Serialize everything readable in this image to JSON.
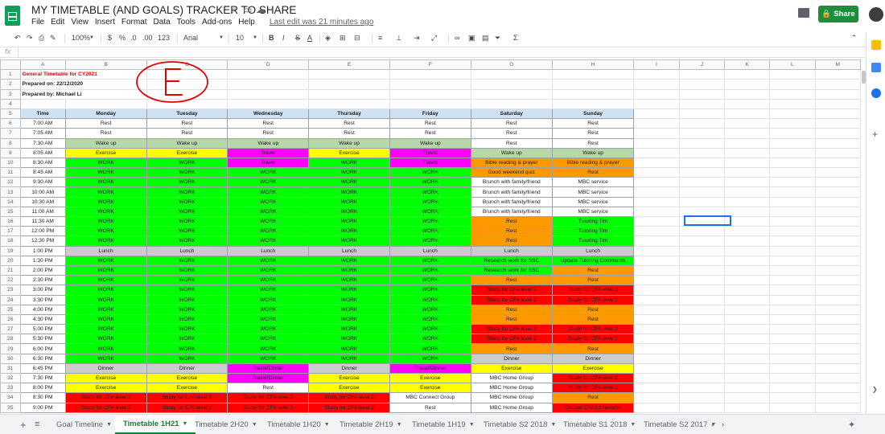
{
  "app": {
    "title": "MY TIMETABLE (AND GOALS) TRACKER TO SHARE",
    "last_edit": "Last edit was 21 minutes ago",
    "share": "Share"
  },
  "menu": [
    "File",
    "Edit",
    "View",
    "Insert",
    "Format",
    "Data",
    "Tools",
    "Add-ons",
    "Help"
  ],
  "toolbar": {
    "zoom": "100%",
    "currency": "$",
    "percent": "%",
    "dec_less": ".0",
    "dec_more": ".00",
    "more_formats": "123",
    "font": "Arial",
    "font_size": "10",
    "bold": "B",
    "italic": "I",
    "strike": "S",
    "text_color": "A"
  },
  "formula_bar": {
    "fx": "fx",
    "value": ""
  },
  "columns": [
    "A",
    "B",
    "C",
    "D",
    "E",
    "F",
    "G",
    "H",
    "I",
    "J",
    "K",
    "L",
    "M"
  ],
  "info_rows": [
    "General Timetable for CY2021",
    "Prepared on: 22/12/2020",
    "Prepared by: Michael Li"
  ],
  "timetable": {
    "header": [
      "Time",
      "Monday",
      "Tuesday",
      "Wednesday",
      "Thursday",
      "Friday",
      "Saturday",
      "Sunday"
    ],
    "rows": [
      [
        "7:00 AM",
        "Rest",
        "Rest",
        "Rest",
        "Rest",
        "Rest",
        "Rest",
        "Rest"
      ],
      [
        "7:05 AM",
        "Rest",
        "Rest",
        "Rest",
        "Rest",
        "Rest",
        "Rest",
        "Rest"
      ],
      [
        "7:30 AM",
        "Wake up",
        "Wake up",
        "Wake up",
        "Wake up",
        "Wake up",
        "Rest",
        "Rest"
      ],
      [
        "8:05 AM",
        "Exercise",
        "Exercise",
        "Travel",
        "Exercise",
        "Travel",
        "Wake up",
        "Wake up"
      ],
      [
        "8:30 AM",
        "WORK",
        "WORK",
        "Travel",
        "WORK",
        "Travel",
        "Bible reading & prayer",
        "Bible reading & prayer"
      ],
      [
        "8:45 AM",
        "WORK",
        "WORK",
        "WORK",
        "WORK",
        "WORK",
        "Good weekend quiz",
        "Rest"
      ],
      [
        "9:30 AM",
        "WORK",
        "WORK",
        "WORK",
        "WORK",
        "WORK",
        "Brunch with family/friend",
        "MBC service"
      ],
      [
        "10:00 AM",
        "WORK",
        "WORK",
        "WORK",
        "WORK",
        "WORK",
        "Brunch with family/friend",
        "MBC service"
      ],
      [
        "10:30 AM",
        "WORK",
        "WORK",
        "WORK",
        "WORK",
        "WORK",
        "Brunch with family/friend",
        "MBC service"
      ],
      [
        "11:00 AM",
        "WORK",
        "WORK",
        "WORK",
        "WORK",
        "WORK",
        "Brunch with family/friend",
        "MBC service"
      ],
      [
        "11:30 AM",
        "WORK",
        "WORK",
        "WORK",
        "WORK",
        "WORK",
        "Rest",
        "Tutoring Tim"
      ],
      [
        "12:00 PM",
        "WORK",
        "WORK",
        "WORK",
        "WORK",
        "WORK",
        "Rest",
        "Tutoring Tim"
      ],
      [
        "12:30 PM",
        "WORK",
        "WORK",
        "WORK",
        "WORK",
        "WORK",
        "Rest",
        "Tutoring Tim"
      ],
      [
        "1:00 PM",
        "Lunch",
        "Lunch",
        "Lunch",
        "Lunch",
        "Lunch",
        "Lunch",
        "Lunch"
      ],
      [
        "1:30 PM",
        "WORK",
        "WORK",
        "WORK",
        "WORK",
        "WORK",
        "Research work for SSC",
        "Update Tutoring Comments"
      ],
      [
        "2:00 PM",
        "WORK",
        "WORK",
        "WORK",
        "WORK",
        "WORK",
        "Research work for SSC",
        "Rest"
      ],
      [
        "2:30 PM",
        "WORK",
        "WORK",
        "WORK",
        "WORK",
        "WORK",
        "Rest",
        "Rest"
      ],
      [
        "3:00 PM",
        "WORK",
        "WORK",
        "WORK",
        "WORK",
        "WORK",
        "Study for CFA level 2",
        "Study for CFA level 2"
      ],
      [
        "3:30 PM",
        "WORK",
        "WORK",
        "WORK",
        "WORK",
        "WORK",
        "Study for CFA level 2",
        "Study for CFA level 2"
      ],
      [
        "4:00 PM",
        "WORK",
        "WORK",
        "WORK",
        "WORK",
        "WORK",
        "Rest",
        "Rest"
      ],
      [
        "4:30 PM",
        "WORK",
        "WORK",
        "WORK",
        "WORK",
        "WORK",
        "Rest",
        "Rest"
      ],
      [
        "5:00 PM",
        "WORK",
        "WORK",
        "WORK",
        "WORK",
        "WORK",
        "Study for CFA level 2",
        "Study for CFA level 2"
      ],
      [
        "5:30 PM",
        "WORK",
        "WORK",
        "WORK",
        "WORK",
        "WORK",
        "Study for CFA level 2",
        "Study for CFA level 2"
      ],
      [
        "6:00 PM",
        "WORK",
        "WORK",
        "WORK",
        "WORK",
        "WORK",
        "Rest",
        "Rest"
      ],
      [
        "6:30 PM",
        "WORK",
        "WORK",
        "WORK",
        "WORK",
        "WORK",
        "Dinner",
        "Dinner"
      ],
      [
        "6:45 PM",
        "Dinner",
        "Dinner",
        "Travel/Dinner",
        "Dinner",
        "Travel/Dinner",
        "Exercise",
        "Exercise"
      ],
      [
        "7:30 PM",
        "Exercise",
        "Exercise",
        "Travel/Dinner",
        "Exercise",
        "Exercise",
        "MBC Home Group",
        "Study for CFA level 2"
      ],
      [
        "8:00 PM",
        "Exercise",
        "Exercise",
        "Rest",
        "Exercise",
        "Exercise",
        "MBC Home Group",
        "Study for CFA level 2"
      ],
      [
        "8:30 PM",
        "Study for CFA level 2",
        "Study for CFA level 2",
        "Study for CFA level 2",
        "Study for CFA level 2",
        "MBC Connect Group",
        "MBC Home Group",
        "Rest"
      ],
      [
        "9:00 PM",
        "Study for CFA level 2",
        "Study for CFA level 2",
        "Study for CFA level 2",
        "Study for CFA level 2",
        "Rest",
        "MBC Home Group",
        "Deeper CFA L2 revision"
      ]
    ]
  },
  "colors": {
    "Rest": "#ffffff",
    "Wake up": "#b6d7a8",
    "Exercise": "#ffff00",
    "Travel": "#ff00ff",
    "Travel/Dinner": "#ff00ff",
    "WORK": "#00ff00",
    "Lunch": "#cccccc",
    "Dinner": "#cccccc",
    "Study for CFA level 2": "#ff0000",
    "Deeper CFA L2 revision": "#ff0000",
    "Bible reading & prayer": "#ff9900",
    "Good weekend quiz": "#ff9900",
    "Tutoring Tim": "#00ff00",
    "Research work for SSC": "#00ff00",
    "Update Tutoring Comments": "#00ff00",
    "MBC service": "#ffffff",
    "Brunch with family/friend": "#ffffff",
    "MBC Home Group": "#ffffff",
    "MBC Connect Group": "#ffffff",
    "weekend_rest": "#ff9900",
    "header": "#cfe2f3",
    "accent": "#188038",
    "annotation": "#e00000"
  },
  "sheet_tabs": [
    "Goal Timeline",
    "Timetable 1H21",
    "Timetable 2H20",
    "Timetable 1H20",
    "Timetable 2H19",
    "Timetable 1H19",
    "Timetable S2 2018",
    "Timetable S1 2018",
    "Timetable S2 2017"
  ],
  "active_tab": "Timetable 1H21"
}
